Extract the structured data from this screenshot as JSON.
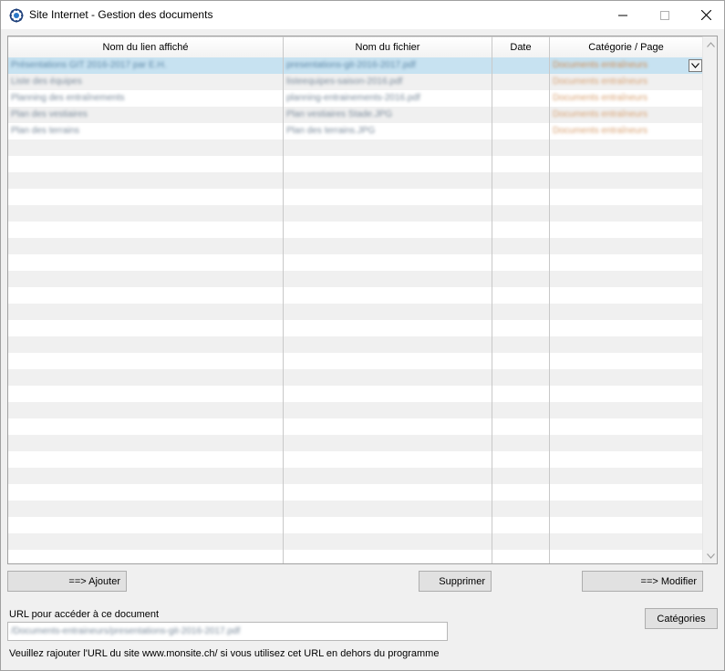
{
  "window": {
    "title": "Site Internet - Gestion des documents",
    "icon": "gear-globe-icon"
  },
  "grid": {
    "columns": [
      "Nom du lien affiché",
      "Nom du fichier",
      "Date",
      "Catégorie / Page"
    ],
    "rows": [
      [
        "Présentations GIT 2016-2017 par E.H.",
        "presentations-git-2016-2017.pdf",
        "",
        "Documents entraîneurs"
      ],
      [
        "Liste des équipes",
        "listeequipes-saison-2016.pdf",
        "",
        "Documents entraîneurs"
      ],
      [
        "Planning des entraînements",
        "planning-entrainements-2016.pdf",
        "",
        "Documents entraîneurs"
      ],
      [
        "Plan des vestiaires",
        "Plan vestiaires Stade.JPG",
        "",
        "Documents entraîneurs"
      ],
      [
        "Plan des terrains",
        "Plan des terrains.JPG",
        "",
        "Documents entraîneurs"
      ]
    ],
    "selected_row": 0,
    "empty_rows": 26
  },
  "buttons": {
    "add": "==>  Ajouter",
    "delete": "Supprimer",
    "modify": "==>  Modifier",
    "categories": "Catégories"
  },
  "url": {
    "label": "URL pour accéder à ce document",
    "value": "/Documents-entraineurs/presentations-git-2016-2017.pdf"
  },
  "note": "Veuillez rajouter l'URL du site www.monsite.ch/  si vous utilisez cet URL en dehors du programme"
}
